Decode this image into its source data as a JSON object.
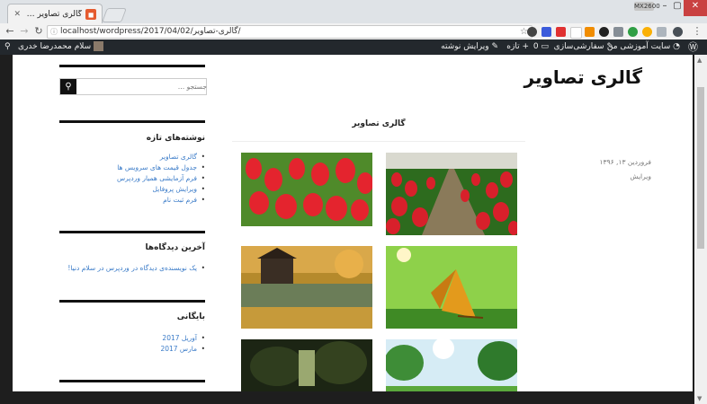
{
  "browser": {
    "tab_title": "گالری تصاویر – سایت آموزش...",
    "profile_label": "MX2600",
    "url": "localhost/wordpress/2017/04/02/گالری-تصاویر/",
    "window_controls": [
      "–",
      "▢",
      "✕"
    ]
  },
  "wp_admin_bar": {
    "site_name": "سایت آموزشی من",
    "customize": "سفارشی‌سازی",
    "comments_count": "0",
    "new_label": "تازه",
    "edit_post": "ویرایش نوشته",
    "greeting": "سلام محمدرضا خدری"
  },
  "site": {
    "title": "گالری تصاویر"
  },
  "post": {
    "title": "گالری تصاویر",
    "date": "فروردین ۱۳, ۱۳۹۶",
    "edit_link": "ویرایش"
  },
  "sidebar": {
    "search_placeholder": "جستجو …",
    "recent_posts_title": "نوشته‌های تازه",
    "recent_posts": [
      "گالری تصاویر",
      "جدول قیمت های سرویس ها",
      "فرم آزمایشی همیار وردپرس",
      "ویرایش پروفایل",
      "فرم ثبت نام"
    ],
    "recent_comments_title": "آخرین دیدگاه‌ها",
    "recent_comments": [
      "یک نویسنده‌ی دیدگاه در وردپرس در سلام دنیا!"
    ],
    "archives_title": "بایگانی",
    "archives": [
      "آوریل 2017",
      "مارس 2017"
    ]
  },
  "gallery": {
    "images": [
      "red-tulip-field-path",
      "red-tulips-closeup",
      "butterfly-on-grass",
      "lake-house-autumn",
      "sunny-meadow-trees",
      "dark-forest-path"
    ]
  },
  "colors": {
    "admin_bar": "#23282d",
    "link": "#3a7bc8",
    "black": "#111111"
  }
}
